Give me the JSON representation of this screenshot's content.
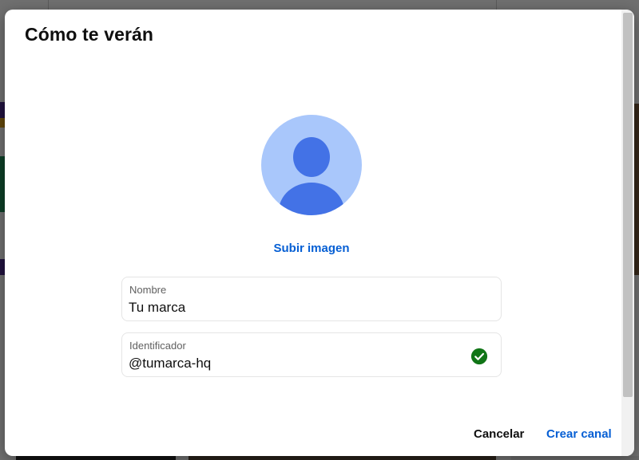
{
  "dialog": {
    "title": "Cómo te verán",
    "upload_label": "Subir imagen",
    "fields": {
      "name": {
        "label": "Nombre",
        "value": "Tu marca"
      },
      "handle": {
        "label": "Identificador",
        "value": "@tumarca-hq",
        "status_icon": "check-circle-icon"
      }
    },
    "buttons": {
      "cancel": "Cancelar",
      "create": "Crear canal"
    }
  },
  "colors": {
    "accent": "#065fd4",
    "avatar_bg": "#a9c7fb",
    "avatar_fg": "#4372e6",
    "success": "#107516",
    "overlay": "rgba(0,0,0,0.56)"
  }
}
